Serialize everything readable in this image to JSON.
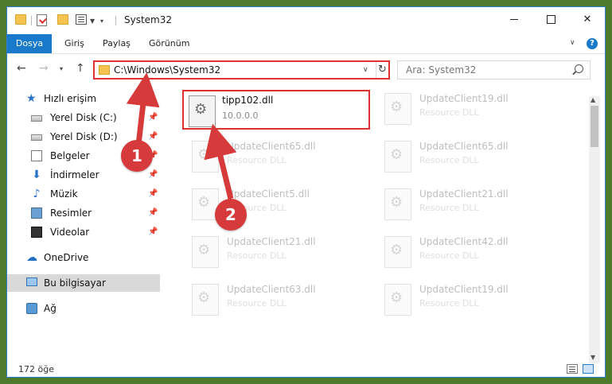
{
  "window": {
    "title": "System32"
  },
  "ribbon": {
    "tabs": [
      "Dosya",
      "Giriş",
      "Paylaş",
      "Görünüm"
    ],
    "help": "?"
  },
  "navigation": {
    "address": "C:\\Windows\\System32",
    "search_placeholder": "Ara: System32"
  },
  "sidebar": {
    "items": [
      {
        "label": "Hızlı erişim",
        "icon": "star-icon"
      },
      {
        "label": "Yerel Disk (C:)",
        "icon": "drive-icon",
        "pinned": true
      },
      {
        "label": "Yerel Disk (D:)",
        "icon": "drive-icon",
        "pinned": true
      },
      {
        "label": "Belgeler",
        "icon": "documents-icon",
        "pinned": true
      },
      {
        "label": "İndirmeler",
        "icon": "download-icon",
        "pinned": true
      },
      {
        "label": "Müzik",
        "icon": "music-icon",
        "pinned": true
      },
      {
        "label": "Resimler",
        "icon": "pictures-icon",
        "pinned": true
      },
      {
        "label": "Videolar",
        "icon": "video-icon",
        "pinned": true
      },
      {
        "label": "OneDrive",
        "icon": "cloud-icon"
      },
      {
        "label": "Bu bilgisayar",
        "icon": "computer-icon",
        "selected": true
      },
      {
        "label": "Ağ",
        "icon": "network-icon"
      }
    ]
  },
  "files": [
    {
      "name": "tipp102.dll",
      "desc": "10.0.0.0",
      "highlighted": true
    },
    {
      "name": "UpdateClient19.dll",
      "desc": "Resource DLL"
    },
    {
      "name": "UpdateClient65.dll",
      "desc": "Resource DLL"
    },
    {
      "name": "UpdateClient65.dll",
      "desc": "Resource DLL"
    },
    {
      "name": "UpdateClient5.dll",
      "desc": "Resource DLL"
    },
    {
      "name": "UpdateClient21.dll",
      "desc": "Resource DLL"
    },
    {
      "name": "UpdateClient21.dll",
      "desc": "Resource DLL"
    },
    {
      "name": "UpdateClient42.dll",
      "desc": "Resource DLL"
    },
    {
      "name": "UpdateClient63.dll",
      "desc": "Resource DLL"
    },
    {
      "name": "UpdateClient19.dll",
      "desc": "Resource DLL"
    }
  ],
  "status": {
    "count": "172 öğe"
  },
  "callouts": [
    "1",
    "2"
  ],
  "colors": {
    "accent": "#1979ca",
    "highlight": "#e03030",
    "callout": "#d73a3a"
  }
}
